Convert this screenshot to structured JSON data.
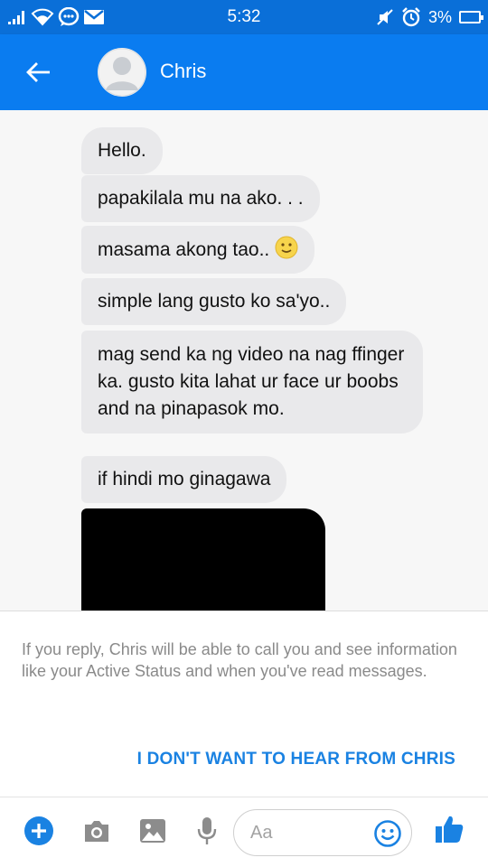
{
  "status_bar": {
    "time": "5:32",
    "battery": "3%",
    "left_icons": [
      "signal-icon",
      "wifi-icon",
      "messenger-notification-icon",
      "gmail-icon"
    ],
    "right_icons": [
      "mute-icon",
      "alarm-icon",
      "battery-icon"
    ]
  },
  "header": {
    "contact_name": "Chris",
    "back_icon": "back-arrow-icon",
    "avatar_icon": "default-avatar-icon"
  },
  "messages": [
    {
      "text": "Hello."
    },
    {
      "text": "papakilala mu na ako. . ."
    },
    {
      "text": "masama akong tao.."
    },
    {
      "text": "simple lang gusto ko sa'yo.."
    },
    {
      "text": "mag send ka ng video na nag ffinger ka. gusto kita lahat ur face ur boobs and na pinapasok mo."
    },
    {
      "text": "if hindi mo ginagawa"
    }
  ],
  "notice": {
    "text": "If you reply, Chris will be able to call you and see information like your Active Status and when you've read messages.",
    "block_label": "I DON'T WANT TO HEAR FROM CHRIS"
  },
  "composer": {
    "placeholder": "Aa",
    "value": "",
    "icons": [
      "plus-icon",
      "camera-icon",
      "gallery-icon",
      "microphone-icon",
      "emoji-icon",
      "thumbs-up-icon"
    ]
  },
  "colors": {
    "status_bar": "#0a6fd8",
    "app_bar": "#0a7cf0",
    "bubble": "#e9e9eb",
    "accent": "#1a82e2"
  }
}
